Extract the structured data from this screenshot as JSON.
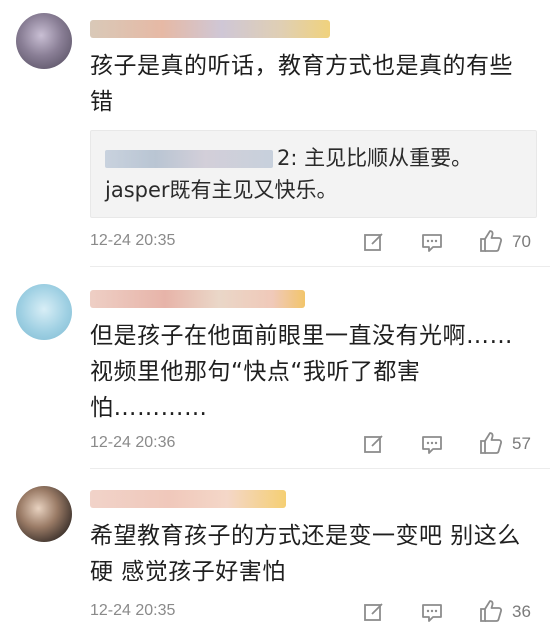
{
  "comments": [
    {
      "text": "孩子是真的听话，教育方式也是真的有些错",
      "reply": {
        "prefix": "2: 主见比顺从重要。",
        "line2": "jasper既有主见又快乐。"
      },
      "time": "12-24 20:35",
      "likes": "70"
    },
    {
      "text": "但是孩子在他面前眼里一直没有光啊……视频里他那句“快点“我听了都害怕…………",
      "time": "12-24 20:36",
      "likes": "57"
    },
    {
      "text": "希望教育孩子的方式还是变一变吧 别这么硬 感觉孩子好害怕",
      "time": "12-24 20:35",
      "likes": "36"
    }
  ],
  "icons": {
    "edit": "edit-icon",
    "reply": "comment-icon",
    "like": "thumbs-up-icon"
  },
  "colors": {
    "text": "#1f1f1f",
    "meta": "#8a8a8a",
    "icon": "#8c8c8c",
    "quote_bg": "#f3f3f3"
  }
}
